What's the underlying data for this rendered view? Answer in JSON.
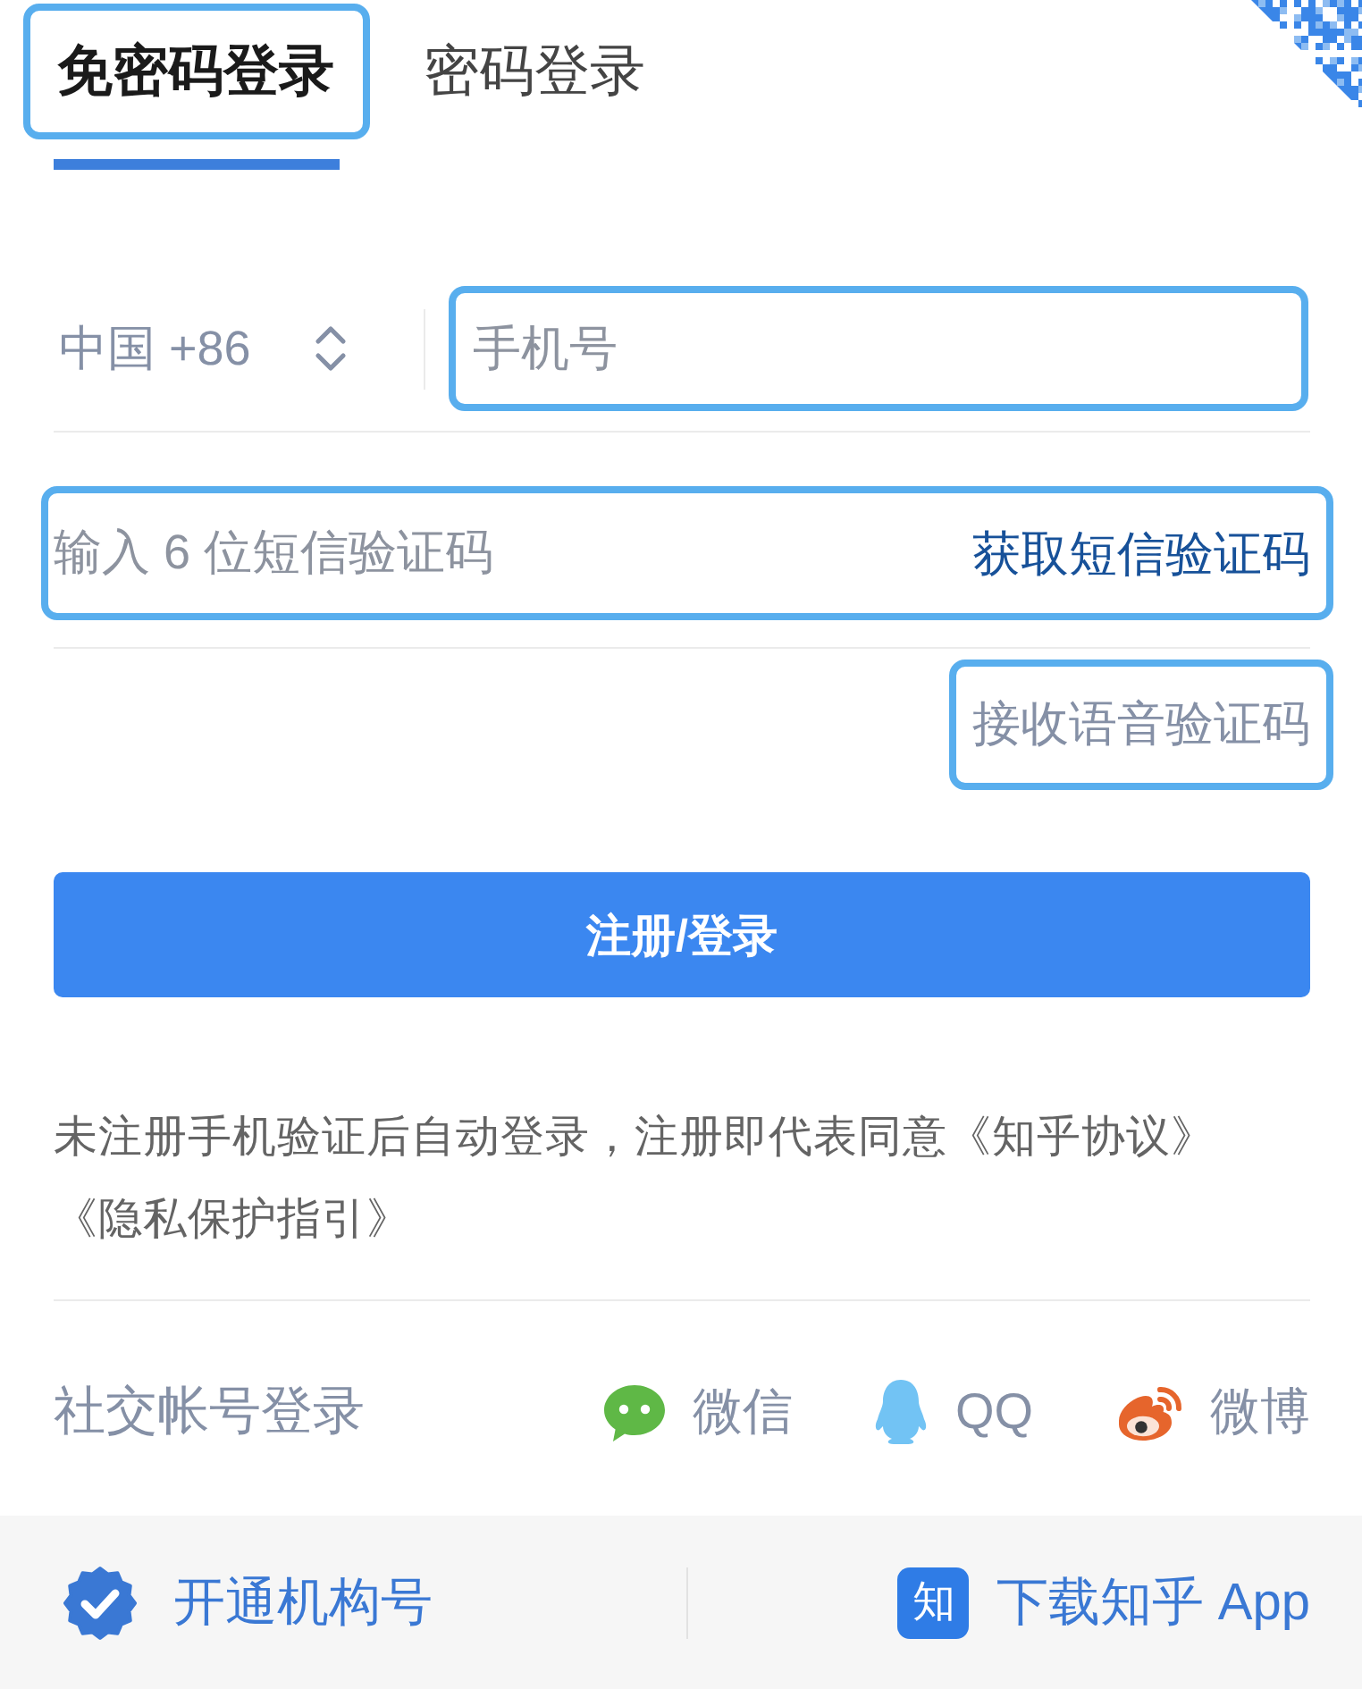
{
  "tabs": [
    {
      "label": "免密码登录",
      "selected": true,
      "highlighted": true
    },
    {
      "label": "密码登录",
      "selected": false,
      "highlighted": false
    }
  ],
  "phone": {
    "country_code": "中国 +86",
    "placeholder": "手机号",
    "highlighted": true
  },
  "sms_code": {
    "placeholder": "输入 6 位短信验证码",
    "get_code_link": "获取短信验证码",
    "highlighted": true
  },
  "voice_code_link": {
    "label": "接收语音验证码",
    "highlighted": true
  },
  "submit_button": "注册/登录",
  "agreement": "未注册手机验证后自动登录，注册即代表同意《知乎协议》《隐私保护指引》",
  "social_login": {
    "label": "社交帐号登录",
    "options": [
      {
        "kind": "wechat",
        "label": "微信"
      },
      {
        "kind": "qq",
        "label": "QQ"
      },
      {
        "kind": "weibo",
        "label": "微博"
      }
    ]
  },
  "footer": {
    "links": [
      {
        "kind": "org",
        "label": "开通机构号"
      },
      {
        "kind": "app",
        "label": "下载知乎 App",
        "icon_text": "知"
      }
    ]
  }
}
